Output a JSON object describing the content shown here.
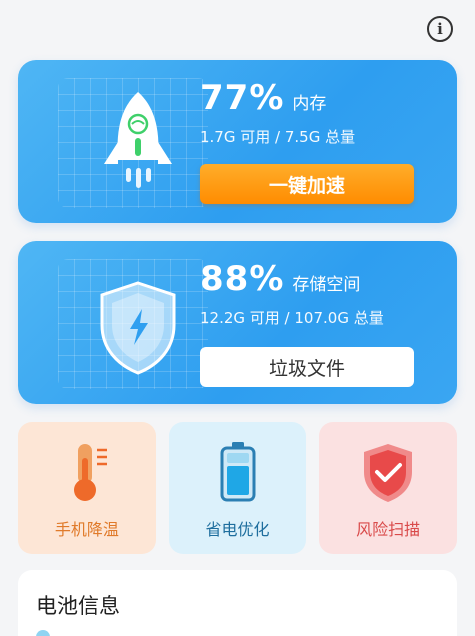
{
  "info_label": "i",
  "memory": {
    "percent": "77%",
    "label": "内存",
    "detail": "1.7G 可用 / 7.5G 总量",
    "button": "一键加速"
  },
  "storage": {
    "percent": "88%",
    "label": "存储空间",
    "detail": "12.2G 可用 / 107.0G 总量",
    "button": "垃圾文件"
  },
  "tiles": [
    {
      "label": "手机降温",
      "icon": "thermometer-icon",
      "color": "#e07a2a"
    },
    {
      "label": "省电优化",
      "icon": "battery-icon",
      "color": "#1e6e9e"
    },
    {
      "label": "风险扫描",
      "icon": "shield-check-icon",
      "color": "#d94a4a"
    }
  ],
  "battery": {
    "title": "电池信息"
  },
  "colors": {
    "card_blue": "#2e9ef0",
    "accent_orange": "#ff8c00"
  }
}
